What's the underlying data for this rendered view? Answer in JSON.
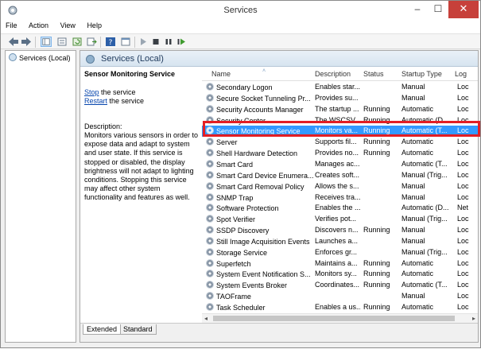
{
  "window": {
    "title": "Services",
    "controls": {
      "minimize": "–",
      "maximize": "☐",
      "close": "✕"
    }
  },
  "menu": [
    "File",
    "Action",
    "View",
    "Help"
  ],
  "tree": {
    "root": "Services (Local)"
  },
  "header": {
    "title": "Services (Local)"
  },
  "details": {
    "service_name": "Sensor Monitoring Service",
    "stop_link": "Stop",
    "stop_rest": " the service",
    "restart_link": "Restart",
    "restart_rest": " the service",
    "description_label": "Description:",
    "description_text": "Monitors various sensors in order to expose data and adapt to system and user state.  If this service is stopped or disabled, the display brightness will not adapt to lighting conditions. Stopping this service may affect other system functionality and features as well."
  },
  "columns": {
    "name": "Name",
    "description": "Description",
    "status": "Status",
    "startup": "Startup Type",
    "log": "Log"
  },
  "services": [
    {
      "name": "Secondary Logon",
      "desc": "Enables star...",
      "status": "",
      "startup": "Manual",
      "log": "Loc"
    },
    {
      "name": "Secure Socket Tunneling Pr...",
      "desc": "Provides su...",
      "status": "",
      "startup": "Manual",
      "log": "Loc"
    },
    {
      "name": "Security Accounts Manager",
      "desc": "The startup ...",
      "status": "Running",
      "startup": "Automatic",
      "log": "Loc"
    },
    {
      "name": "Security Center",
      "desc": "The WSCSV...",
      "status": "Running",
      "startup": "Automatic (D...",
      "log": "Loc"
    },
    {
      "name": "Sensor Monitoring Service",
      "desc": "Monitors va...",
      "status": "Running",
      "startup": "Automatic (T...",
      "log": "Loc"
    },
    {
      "name": "Server",
      "desc": "Supports fil...",
      "status": "Running",
      "startup": "Automatic",
      "log": "Loc"
    },
    {
      "name": "Shell Hardware Detection",
      "desc": "Provides no...",
      "status": "Running",
      "startup": "Automatic",
      "log": "Loc"
    },
    {
      "name": "Smart Card",
      "desc": "Manages ac...",
      "status": "",
      "startup": "Automatic (T...",
      "log": "Loc"
    },
    {
      "name": "Smart Card Device Enumera...",
      "desc": "Creates soft...",
      "status": "",
      "startup": "Manual (Trig...",
      "log": "Loc"
    },
    {
      "name": "Smart Card Removal Policy",
      "desc": "Allows the s...",
      "status": "",
      "startup": "Manual",
      "log": "Loc"
    },
    {
      "name": "SNMP Trap",
      "desc": "Receives tra...",
      "status": "",
      "startup": "Manual",
      "log": "Loc"
    },
    {
      "name": "Software Protection",
      "desc": "Enables the ...",
      "status": "",
      "startup": "Automatic (D...",
      "log": "Net"
    },
    {
      "name": "Spot Verifier",
      "desc": "Verifies pot...",
      "status": "",
      "startup": "Manual (Trig...",
      "log": "Loc"
    },
    {
      "name": "SSDP Discovery",
      "desc": "Discovers n...",
      "status": "Running",
      "startup": "Manual",
      "log": "Loc"
    },
    {
      "name": "Still Image Acquisition Events",
      "desc": "Launches a...",
      "status": "",
      "startup": "Manual",
      "log": "Loc"
    },
    {
      "name": "Storage Service",
      "desc": "Enforces gr...",
      "status": "",
      "startup": "Manual (Trig...",
      "log": "Loc"
    },
    {
      "name": "Superfetch",
      "desc": "Maintains a...",
      "status": "Running",
      "startup": "Automatic",
      "log": "Loc"
    },
    {
      "name": "System Event Notification S...",
      "desc": "Monitors sy...",
      "status": "Running",
      "startup": "Automatic",
      "log": "Loc"
    },
    {
      "name": "System Events Broker",
      "desc": "Coordinates...",
      "status": "Running",
      "startup": "Automatic (T...",
      "log": "Loc"
    },
    {
      "name": "TAOFrame",
      "desc": "",
      "status": "",
      "startup": "Manual",
      "log": "Loc"
    },
    {
      "name": "Task Scheduler",
      "desc": "Enables a us...",
      "status": "Running",
      "startup": "Automatic",
      "log": "Loc"
    }
  ],
  "selected_index": 4,
  "tabs": {
    "extended": "Extended",
    "standard": "Standard"
  },
  "colors": {
    "selection": "#3399ff",
    "highlight_box": "#e31e24",
    "close_button": "#c7403a"
  },
  "scrollbar": {
    "left_arrow": "◂",
    "right_arrow": "▸"
  }
}
